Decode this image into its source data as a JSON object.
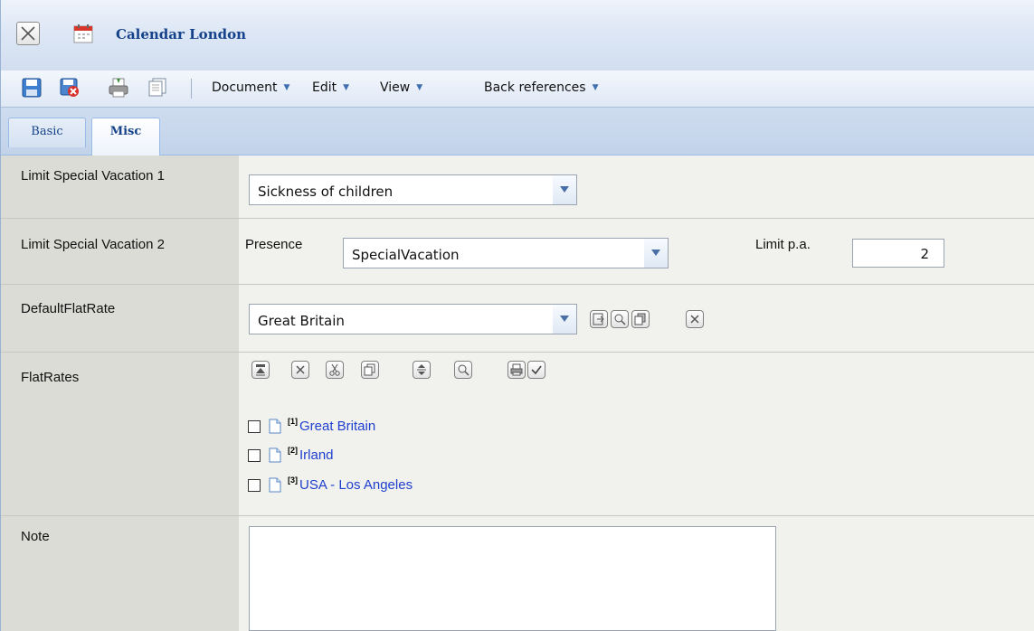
{
  "window": {
    "title": "Calendar London"
  },
  "toolbar": {
    "menus": [
      {
        "label": "Document"
      },
      {
        "label": "Edit"
      },
      {
        "label": "View"
      },
      {
        "label": "Back references"
      }
    ]
  },
  "tabs": [
    {
      "label": "Basic",
      "active": false
    },
    {
      "label": "Misc",
      "active": true
    }
  ],
  "form": {
    "limit_special_vacation_1": {
      "label": "Limit Special Vacation 1",
      "value": "Sickness of children"
    },
    "limit_special_vacation_2": {
      "label": "Limit Special Vacation 2",
      "presence_label": "Presence",
      "presence_value": "SpecialVacation",
      "limit_label": "Limit p.a.",
      "limit_value": "2"
    },
    "default_flat_rate": {
      "label": "DefaultFlatRate",
      "value": "Great Britain"
    },
    "flat_rates": {
      "label": "FlatRates",
      "items": [
        {
          "index": "[1]",
          "name": "Great Britain",
          "checked": false
        },
        {
          "index": "[2]",
          "name": "Irland",
          "checked": false
        },
        {
          "index": "[3]",
          "name": "USA - Los Angeles",
          "checked": false
        }
      ]
    },
    "note": {
      "label": "Note",
      "value": ""
    }
  },
  "colors": {
    "title_text": "#15428b",
    "link": "#1f3fcf",
    "label_column": "#dcdcd6",
    "field_area": "#f1f1ed"
  }
}
